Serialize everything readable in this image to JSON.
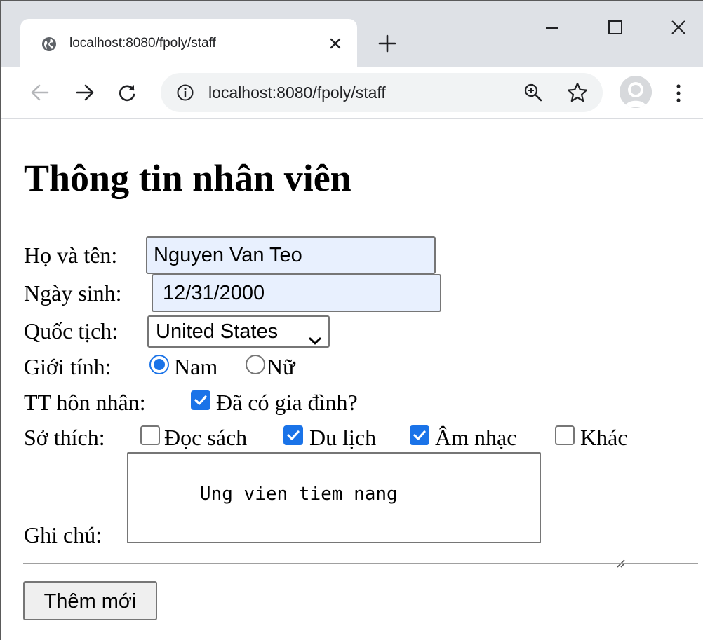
{
  "browser": {
    "tab_title": "localhost:8080/fpoly/staff",
    "url": "localhost:8080/fpoly/staff",
    "colors": {
      "tabstrip_bg": "#dee1e6",
      "omnibox_bg": "#f1f3f4",
      "accent": "#1a73e8",
      "autofill_bg": "#e8f0fe"
    }
  },
  "form": {
    "title": "Thông tin nhân viên",
    "fullname": {
      "label": "Họ và tên:",
      "value": "Nguyen Van Teo"
    },
    "birthday": {
      "label": "Ngày sinh:",
      "value": "12/31/2000"
    },
    "country": {
      "label": "Quốc tịch:",
      "selected": "United States"
    },
    "gender": {
      "label": "Giới tính:",
      "options": [
        {
          "label": "Nam",
          "checked": true
        },
        {
          "label": "Nữ",
          "checked": false
        }
      ]
    },
    "marital": {
      "label": "TT hôn nhân:",
      "option_label": "Đã có gia đình?",
      "checked": true
    },
    "hobbies": {
      "label": "Sở thích:",
      "options": [
        {
          "label": "Đọc sách",
          "checked": false
        },
        {
          "label": "Du lịch",
          "checked": true
        },
        {
          "label": "Âm nhạc",
          "checked": true
        },
        {
          "label": "Khác",
          "checked": false
        }
      ]
    },
    "notes": {
      "label": "Ghi chú:",
      "value": "Ung vien tiem nang"
    },
    "submit_label": "Thêm mới"
  }
}
